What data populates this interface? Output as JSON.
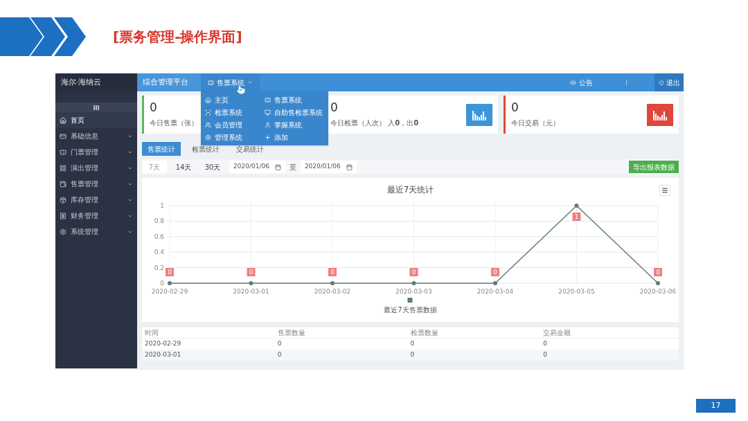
{
  "slide": {
    "title": "[票务管理-操作界面]",
    "page_number": "17"
  },
  "app": {
    "brand": "海尔·海纳云",
    "title": "综合管理平台",
    "nav_menu": {
      "label": "售票系统",
      "expanded": true
    },
    "notice": "公告",
    "logout": "退出"
  },
  "dropdown": [
    {
      "label": "主页"
    },
    {
      "label": "售票系统"
    },
    {
      "label": "检票系统"
    },
    {
      "label": "自助售检票系统"
    },
    {
      "label": "会员管理"
    },
    {
      "label": "掌握系统"
    },
    {
      "label": "管理系统"
    },
    {
      "label": "添加"
    }
  ],
  "sidebar": [
    {
      "label": "首页",
      "has_submenu": false,
      "selected": true
    },
    {
      "label": "基础信息",
      "has_submenu": true,
      "selected": false
    },
    {
      "label": "门票管理",
      "has_submenu": true,
      "selected": false
    },
    {
      "label": "演出管理",
      "has_submenu": true,
      "selected": false
    },
    {
      "label": "售票管理",
      "has_submenu": true,
      "selected": false
    },
    {
      "label": "库存管理",
      "has_submenu": true,
      "selected": false
    },
    {
      "label": "财务管理",
      "has_submenu": true,
      "selected": false
    },
    {
      "label": "系统管理",
      "has_submenu": true,
      "selected": false
    }
  ],
  "stats": [
    {
      "value": "0",
      "label": "今日售票（张）",
      "color": "#5cb85c"
    },
    {
      "value": "0",
      "label": "今日检票（人次） 入**0**，出**0**",
      "color": "#3c95d8",
      "chart_icon": true
    },
    {
      "value": "0",
      "label": "今日交易（元）",
      "color": "#e0463a",
      "chart_icon": true
    }
  ],
  "tabs": [
    {
      "label": "售票统计",
      "selected": true
    },
    {
      "label": "检票统计",
      "selected": false
    },
    {
      "label": "交易统计",
      "selected": false
    }
  ],
  "range_buttons": [
    {
      "label": "7天",
      "selected": true
    },
    {
      "label": "14天",
      "selected": false
    },
    {
      "label": "30天",
      "selected": false
    }
  ],
  "date_from": "2020/01/06",
  "date_separator": "至",
  "date_to": "2020/01/06",
  "export_button": "导出报表数据",
  "chart": {
    "chart_data": {
      "type": "line",
      "title": "最近7天统计",
      "categories": [
        "2020-02-29",
        "2020-03-01",
        "2020-03-02",
        "2020-03-03",
        "2020-03-04",
        "2020-03-05",
        "2020-03-06"
      ],
      "series": [
        {
          "name": "最近7天售票数据",
          "color": "#5f7d78",
          "values": [
            0,
            0,
            0,
            0,
            0,
            1,
            0
          ]
        }
      ],
      "ylim": [
        0,
        1
      ],
      "yticks": [
        0,
        0.2,
        0.4,
        0.6,
        0.8,
        1
      ],
      "data_labels": true,
      "grid": true,
      "marker": true
    }
  },
  "table": {
    "columns": [
      "时间",
      "售票数量",
      "检票数量",
      "交易金额"
    ],
    "rows": [
      [
        "2020-02-29",
        "0",
        "0",
        "0"
      ],
      [
        "2020-03-01",
        "0",
        "0",
        "0"
      ]
    ]
  }
}
